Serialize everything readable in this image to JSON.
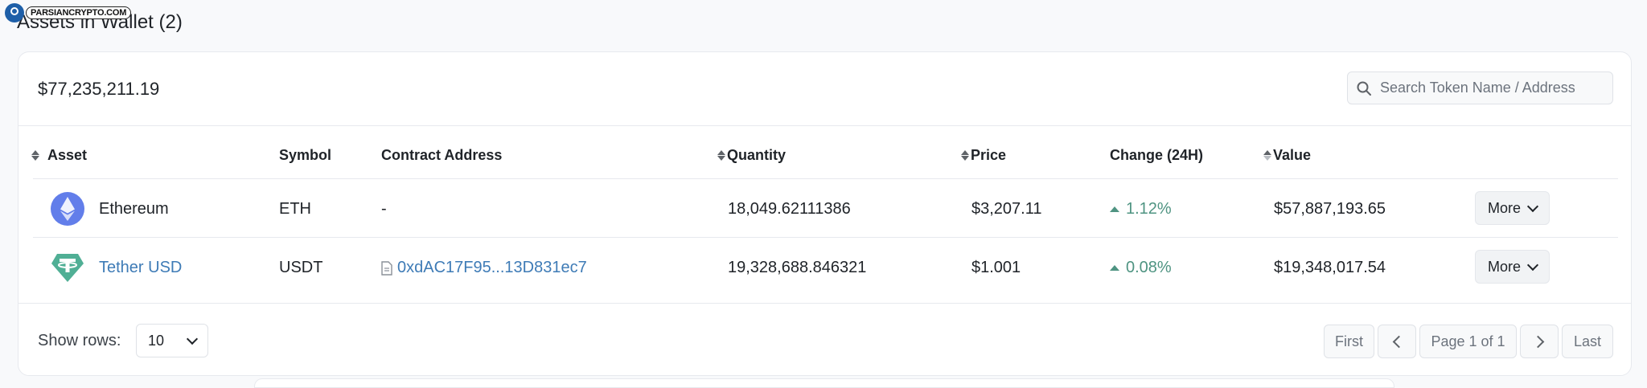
{
  "watermark": {
    "text": "PARSIANCRYPTO.COM"
  },
  "page": {
    "title": "Assets in Wallet (2)"
  },
  "summary": {
    "total_value": "$77,235,211.19",
    "search_placeholder": "Search Token Name / Address"
  },
  "table": {
    "headers": {
      "asset": "Asset",
      "symbol": "Symbol",
      "contract": "Contract Address",
      "quantity": "Quantity",
      "price": "Price",
      "change": "Change (24H)",
      "value": "Value"
    },
    "rows": [
      {
        "asset": "Ethereum",
        "icon": "ethereum-icon",
        "symbol": "ETH",
        "contract": "-",
        "quantity": "18,049.62111386",
        "price": "$3,207.11",
        "change": "1.12%",
        "value": "$57,887,193.65",
        "more_label": "More"
      },
      {
        "asset": "Tether USD",
        "icon": "tether-icon",
        "symbol": "USDT",
        "contract": "0xdAC17F95...13D831ec7",
        "quantity": "19,328,688.846321",
        "price": "$1.001",
        "change": "0.08%",
        "value": "$19,348,017.54",
        "more_label": "More"
      }
    ]
  },
  "footer": {
    "show_rows_label": "Show rows:",
    "rows_per_page": "10",
    "first_label": "First",
    "page_label": "Page 1 of 1",
    "last_label": "Last"
  },
  "colors": {
    "accent_link": "#3e7bb6",
    "positive_change": "#4f9482",
    "ethereum": "#627eea",
    "tether": "#50af95"
  }
}
